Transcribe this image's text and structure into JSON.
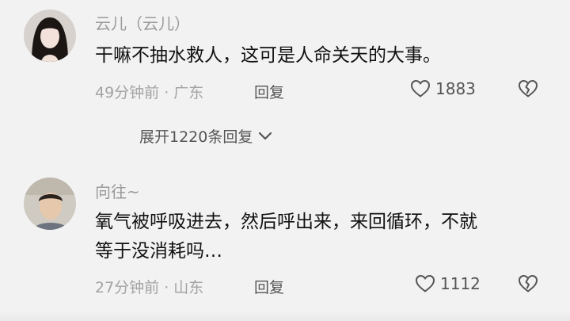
{
  "comments": [
    {
      "username": "云儿（云儿）",
      "content_lines": [
        "干嘛不抽水救人，这可是人命关天的大事。"
      ],
      "time": "49分钟前",
      "location": "广东",
      "reply_label": "回复",
      "likes": "1883",
      "expand_label": "展开1220条回复"
    },
    {
      "username": "向往~",
      "content_lines": [
        "氧气被呼吸进去，然后呼出来，来回循环，不就",
        "等于没消耗吗…"
      ],
      "time": "27分钟前",
      "location": "山东",
      "reply_label": "回复",
      "likes": "1112"
    }
  ],
  "separator": "·",
  "icons": {
    "like": "heart-outline-icon",
    "dislike": "broken-heart-icon",
    "expand": "chevron-down-icon"
  }
}
